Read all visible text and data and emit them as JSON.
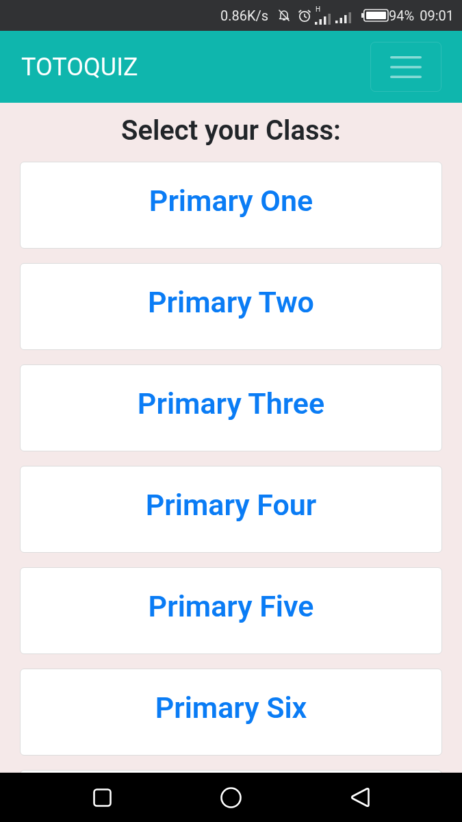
{
  "status_bar": {
    "network_speed": "0.86K/s",
    "network_type": "H",
    "battery": "94%",
    "time": "09:01"
  },
  "navbar": {
    "brand": "TOTOQUIZ"
  },
  "page": {
    "heading": "Select your Class:",
    "classes": [
      {
        "label": "Primary One"
      },
      {
        "label": "Primary Two"
      },
      {
        "label": "Primary Three"
      },
      {
        "label": "Primary Four"
      },
      {
        "label": "Primary Five"
      },
      {
        "label": "Primary Six"
      }
    ]
  }
}
